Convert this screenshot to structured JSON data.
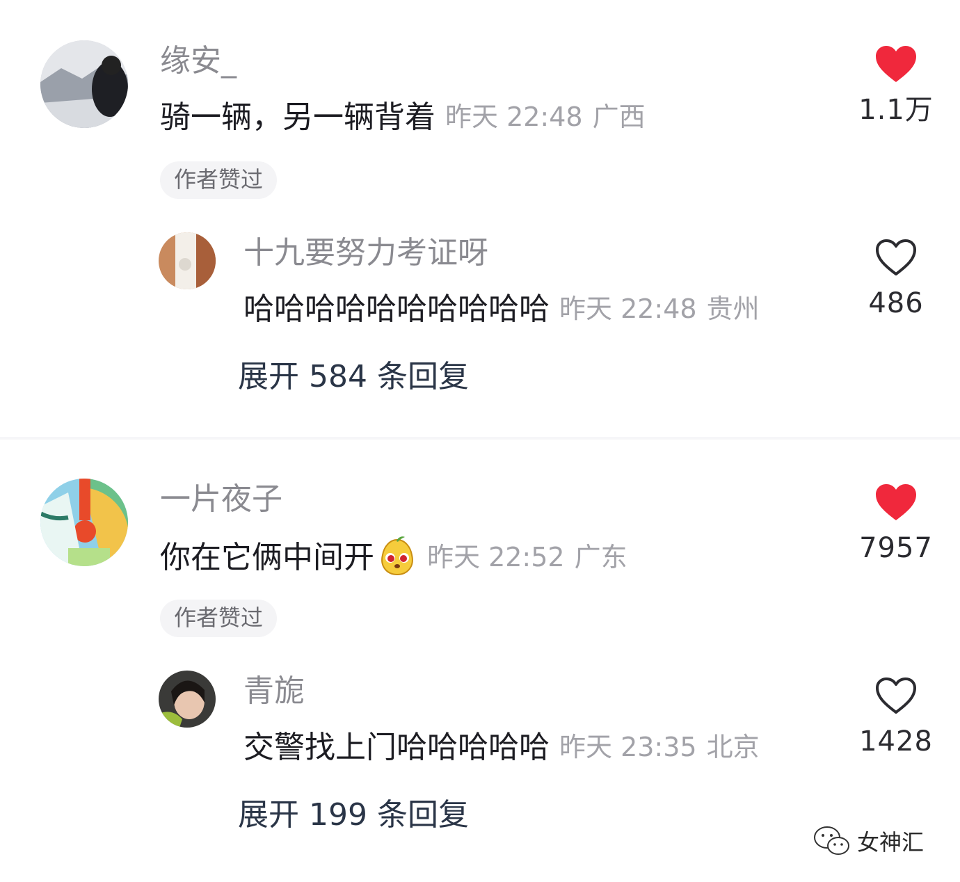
{
  "comments": [
    {
      "user": "缘安_",
      "text": "骑一辆，另一辆背着",
      "time": "昨天 22:48",
      "location": "广西",
      "likes": "1.1万",
      "liked": true,
      "badge": "作者赞过",
      "reply": {
        "user": "十九要努力考证呀",
        "text": "哈哈哈哈哈哈哈哈哈哈",
        "time": "昨天 22:48",
        "location": "贵州",
        "likes": "486",
        "liked": false
      },
      "expand": "展开 584 条回复"
    },
    {
      "user": "一片夜子",
      "text": "你在它俩中间开",
      "emoji": "pear-face-emoji",
      "time": "昨天 22:52",
      "location": "广东",
      "likes": "7957",
      "liked": true,
      "badge": "作者赞过",
      "reply": {
        "user": "青旎",
        "text": "交警找上门哈哈哈哈哈",
        "time": "昨天 23:35",
        "location": "北京",
        "likes": "1428",
        "liked": false
      },
      "expand": "展开 199 条回复"
    }
  ],
  "watermark": {
    "icon": "wechat-icon",
    "text": "女神汇"
  },
  "colors": {
    "heart_liked": "#f0283c",
    "heart_outline": "#2b2b30",
    "meta": "#a2a2a8",
    "name": "#8a8a90"
  }
}
